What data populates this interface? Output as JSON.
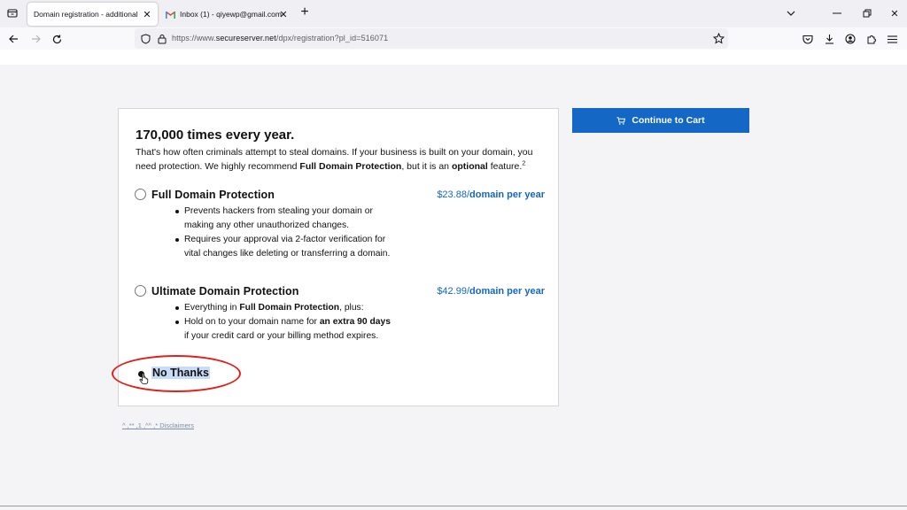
{
  "browser": {
    "tabs": [
      {
        "title": "Domain registration - additional of",
        "active": true
      },
      {
        "title": "Inbox (1) - qiyewp@gmail.com",
        "active": false
      }
    ],
    "url": {
      "prefix": "https://www.",
      "host": "secureserver.net",
      "path": "/dpx/registration?pl_id=516071"
    }
  },
  "card": {
    "headline": "170,000 times every year.",
    "intro_1": "That's how often criminals attempt to steal domains. If your business is built on your domain, you need protection. We highly recommend ",
    "intro_bold_1": "Full Domain Protection",
    "intro_2": ", but it is an ",
    "intro_bold_2": "optional",
    "intro_3": " feature.",
    "intro_sup": "2",
    "options": [
      {
        "title": "Full Domain Protection",
        "price": "$23.88/",
        "price_unit": "domain per year",
        "bullets": [
          "Prevents hackers from stealing your domain or making any other unauthorized changes.",
          "Requires your approval via 2-factor verification for vital changes like deleting or transferring a domain."
        ]
      },
      {
        "title": "Ultimate Domain Protection",
        "price": "$42.99/",
        "price_unit": "domain per year",
        "bullet_1_pre": "Everything in ",
        "bullet_1_bold": "Full Domain Protection",
        "bullet_1_post": ", plus:",
        "bullet_2_pre": "Hold on to your domain name for ",
        "bullet_2_bold": "an extra 90 days",
        "bullet_2_post": " if your credit card or your billing method expires."
      }
    ],
    "no_thanks": "No Thanks",
    "no_thanks_selected": true
  },
  "disclaimers": "^ ,** ,1 ,^^ ,* Disclaimers",
  "cart_button": "Continue to Cart",
  "colors": {
    "accent": "#1467c4",
    "annotation": "#e0201c",
    "selection": "#c9dcf6"
  }
}
